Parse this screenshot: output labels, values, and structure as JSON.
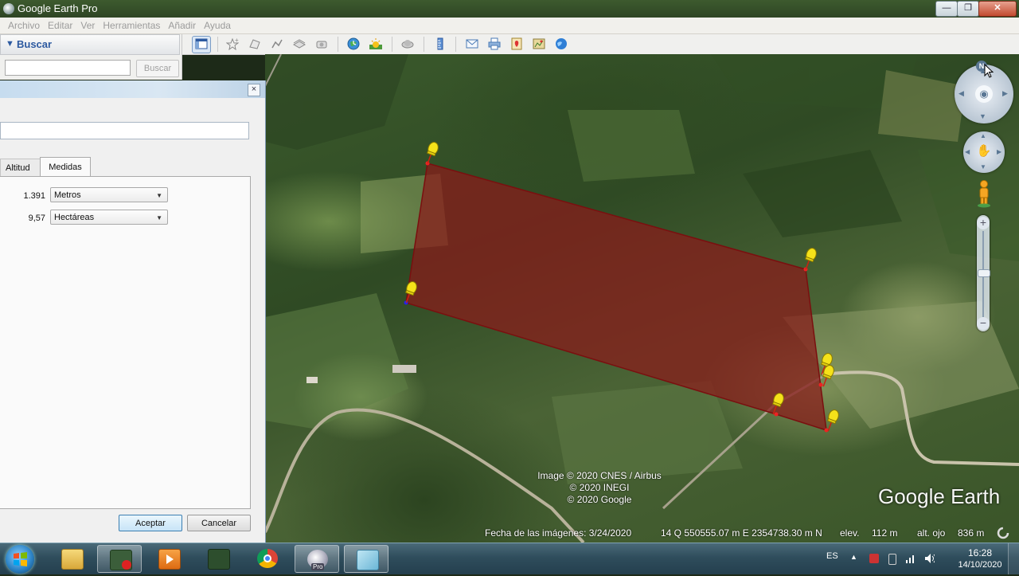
{
  "window": {
    "title": "Google Earth Pro",
    "min": "—",
    "max": "❐",
    "close": "✕"
  },
  "menu": [
    "Archivo",
    "Editar",
    "Ver",
    "Herramientas",
    "Añadir",
    "Ayuda"
  ],
  "search": {
    "header": "Buscar",
    "button": "Buscar",
    "value": ""
  },
  "dialog": {
    "close": "×",
    "name_value": "",
    "tabs": {
      "altitud": "Altitud",
      "medidas": "Medidas"
    },
    "perimeter": {
      "value": "1.391",
      "unit": "Metros"
    },
    "area": {
      "value": "9,57",
      "unit": "Hectáreas"
    },
    "ok": "Aceptar",
    "cancel": "Cancelar"
  },
  "map": {
    "attribution": [
      "Image © 2020 CNES / Airbus",
      "© 2020 INEGI",
      "© 2020 Google"
    ],
    "logo": "Google Earth",
    "status": {
      "imagery_date": "Fecha de las imágenes: 3/24/2020",
      "coords": "14 Q 550555.07 m E 2354738.30 m N",
      "elev_label": "elev.",
      "elev_value": "112 m",
      "eye_label": "alt. ojo",
      "eye_value": "836 m"
    },
    "compass_north": "N",
    "zoom_in": "+",
    "zoom_out": "−",
    "polygon_fill": "#8b1a1a"
  },
  "taskbar": {
    "pro_badge": "Pro",
    "language": "ES",
    "time": "16:28",
    "date": "14/10/2020"
  }
}
